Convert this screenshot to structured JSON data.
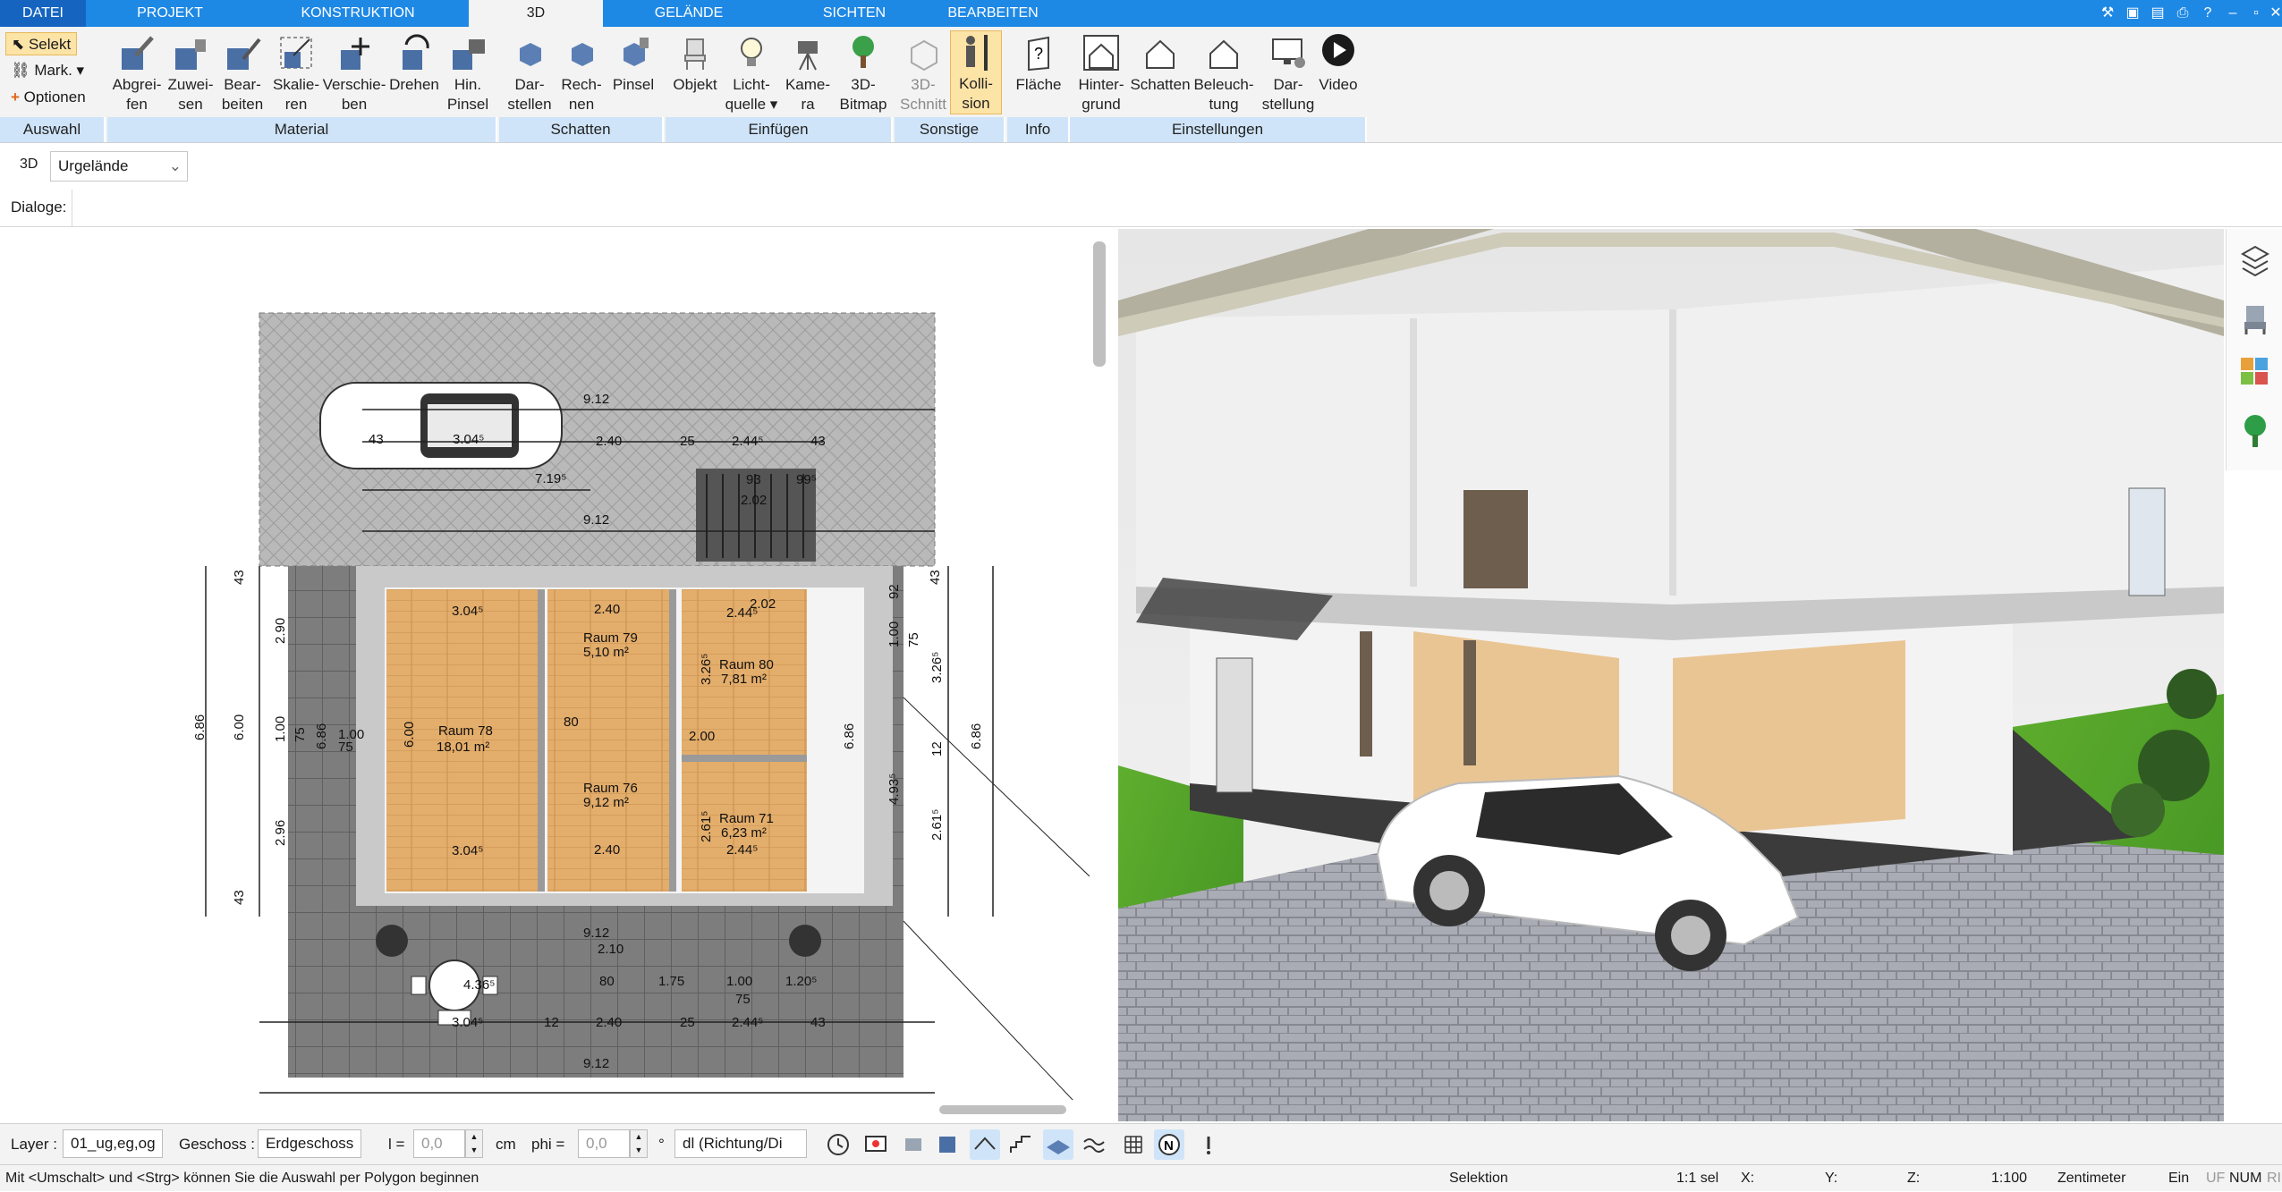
{
  "tabs": [
    {
      "label": "DATEI"
    },
    {
      "label": "PROJEKT"
    },
    {
      "label": "KONSTRUKTION"
    },
    {
      "label": "3D"
    },
    {
      "label": "GELÄNDE"
    },
    {
      "label": "SICHTEN"
    },
    {
      "label": "BEARBEITEN"
    }
  ],
  "auswahl": {
    "selekt": "Selekt",
    "mark": "Mark.",
    "optionen": "Optionen",
    "group": "Auswahl"
  },
  "ribbon": {
    "material": {
      "group": "Material",
      "buttons": [
        {
          "l1": "Abgrei-",
          "l2": "fen"
        },
        {
          "l1": "Zuwei-",
          "l2": "sen"
        },
        {
          "l1": "Bear-",
          "l2": "beiten"
        },
        {
          "l1": "Skalie-",
          "l2": "ren"
        },
        {
          "l1": "Verschie-",
          "l2": "ben"
        },
        {
          "l1": "Drehen",
          "l2": ""
        },
        {
          "l1": "Hin.",
          "l2": "Pinsel"
        }
      ]
    },
    "schatten": {
      "group": "Schatten",
      "buttons": [
        {
          "l1": "Dar-",
          "l2": "stellen"
        },
        {
          "l1": "Rech-",
          "l2": "nen"
        },
        {
          "l1": "Pinsel",
          "l2": ""
        }
      ]
    },
    "einfuegen": {
      "group": "Einfügen",
      "buttons": [
        {
          "l1": "Objekt",
          "l2": ""
        },
        {
          "l1": "Licht-",
          "l2": "quelle ▾"
        },
        {
          "l1": "Kame-",
          "l2": "ra"
        },
        {
          "l1": "3D-",
          "l2": "Bitmap"
        }
      ]
    },
    "sonstige": {
      "group": "Sonstige",
      "buttons": [
        {
          "l1": "3D-",
          "l2": "Schnitt"
        },
        {
          "l1": "Kolli-",
          "l2": "sion"
        }
      ]
    },
    "info": {
      "group": "Info",
      "buttons": [
        {
          "l1": "Fläche",
          "l2": ""
        }
      ]
    },
    "einstellungen": {
      "group": "Einstellungen",
      "buttons": [
        {
          "l1": "Hinter-",
          "l2": "grund"
        },
        {
          "l1": "Schatten",
          "l2": ""
        },
        {
          "l1": "Beleuch-",
          "l2": "tung"
        },
        {
          "l1": "Dar-",
          "l2": "stellung"
        },
        {
          "l1": "Video",
          "l2": ""
        }
      ]
    }
  },
  "toolrow": {
    "mode": "3D",
    "terrain": "Urgelände"
  },
  "dialogs": {
    "label": "Dialoge:"
  },
  "plan": {
    "dims": [
      "9.12",
      "2.40",
      "25",
      "2.44⁵",
      "43",
      "7.19⁵",
      "93",
      "99⁵",
      "2.02",
      "9.12",
      "3.04⁵",
      "2.40",
      "2.44⁵",
      "3.04⁵",
      "2.40",
      "2.44⁵",
      "9.12",
      "2.10",
      "80",
      "1.75",
      "1.00",
      "75",
      "1.20⁵",
      "4.36⁵",
      "3.04⁵",
      "12",
      "2.40",
      "25",
      "2.44⁵",
      "43",
      "9.12",
      "80",
      "2.00",
      "2.02",
      "6.86",
      "6.00",
      "43",
      "2.90",
      "2.96",
      "43",
      "1.00",
      "75",
      "6.86",
      "6.00",
      "1.00",
      "75",
      "3.26⁵",
      "2.61⁵",
      "43",
      "6.86",
      "1.00",
      "75",
      "12",
      "3.26⁵",
      "2.61⁵",
      "4.93⁵",
      "92",
      "6.86"
    ],
    "rooms": [
      {
        "name": "Raum 78",
        "area": "18,01 m²"
      },
      {
        "name": "Raum 79",
        "area": "5,10 m²"
      },
      {
        "name": "Raum 80",
        "area": "7,81 m²"
      },
      {
        "name": "Raum 76",
        "area": "9,12 m²"
      },
      {
        "name": "Raum 71",
        "area": "6,23 m²"
      }
    ],
    "car_label": "3.04⁵",
    "car_small": "43"
  },
  "bottom": {
    "layer_label": "Layer :",
    "layer_value": "01_ug,eg,og",
    "geschoss_label": "Geschoss :",
    "geschoss_value": "Erdgeschoss",
    "l_label": "l =",
    "l_value": "0,0",
    "l_unit": "cm",
    "phi_label": "phi =",
    "phi_value": "0,0",
    "phi_unit": "°",
    "direction": "dl (Richtung/Di"
  },
  "status": {
    "hint": "Mit <Umschalt> und <Strg> können Sie die Auswahl per Polygon beginnen",
    "mode": "Selektion",
    "sel": "1:1 sel",
    "x": "X:",
    "y": "Y:",
    "z": "Z:",
    "scale": "1:100",
    "unit": "Zentimeter",
    "ein": "Ein",
    "uf": "UF",
    "num": "NUM",
    "ri": "RI"
  },
  "colors": {
    "accent": "#1e88e5",
    "active_tab": "#f3f3f3",
    "group_bg": "#cfe4f8",
    "highlight": "#fce3a6"
  }
}
